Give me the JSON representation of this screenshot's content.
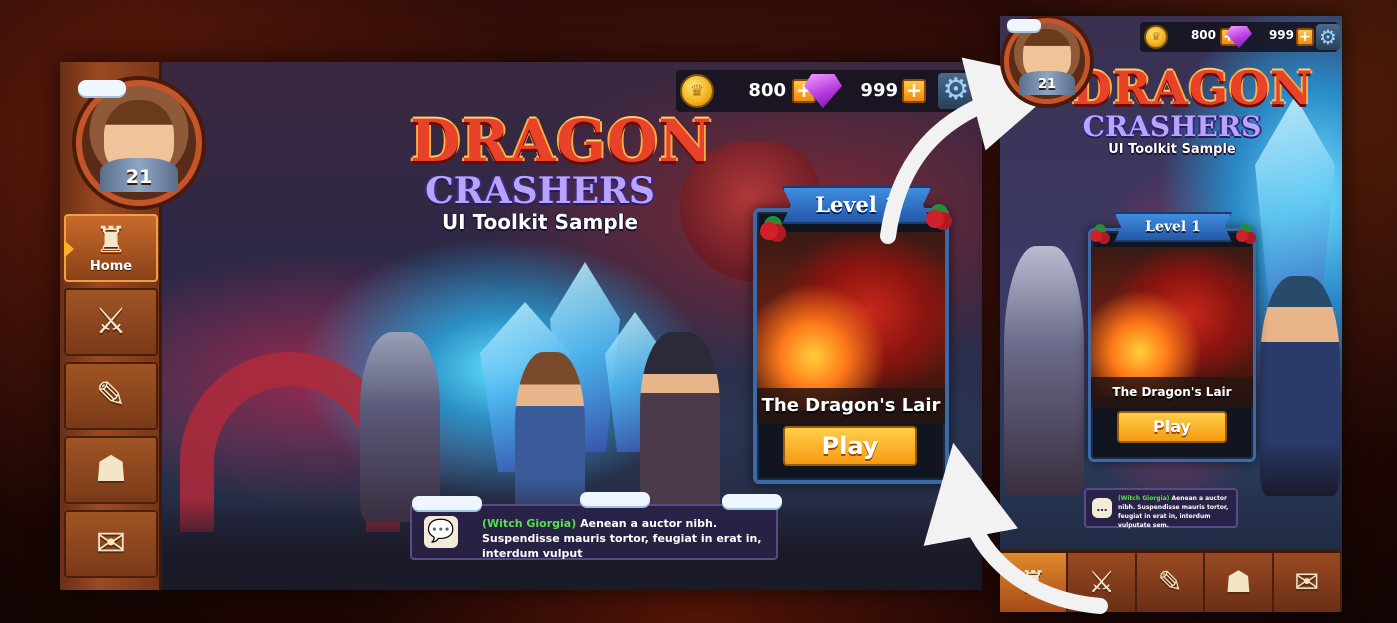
{
  "landscape": {
    "player": {
      "level": "21"
    },
    "nav": [
      {
        "label": "Home",
        "icon": "castle-icon",
        "glyph": "♜",
        "active": true
      },
      {
        "label": "",
        "icon": "shield-sword-icon",
        "glyph": "⚔"
      },
      {
        "label": "",
        "icon": "scroll-quill-icon",
        "glyph": "✎"
      },
      {
        "label": "",
        "icon": "loot-sack-icon",
        "glyph": "☗"
      },
      {
        "label": "",
        "icon": "mail-icon",
        "glyph": "✉"
      }
    ],
    "resources": {
      "gold": "800",
      "gems": "999",
      "plus": "+",
      "gear_glyph": "⚙"
    },
    "logo": {
      "line1": "DRAGON",
      "line2": "CRASHERS",
      "line3": "UI Toolkit Sample"
    },
    "level_card": {
      "title": "Level 1",
      "level_name": "The Dragon's Lair",
      "play_label": "Play"
    },
    "chat": {
      "speaker": "(Witch Giorgia)",
      "message": "Aenean a auctor nibh. Suspendisse mauris tortor, feugiat in erat in, interdum vulput",
      "icon_glyph": "💬"
    }
  },
  "portrait": {
    "player": {
      "level": "21"
    },
    "resources": {
      "gold": "800",
      "gems": "999",
      "plus": "+",
      "gear_glyph": "⚙"
    },
    "logo": {
      "line1": "DRAGON",
      "line2": "CRASHERS",
      "line3": "UI Toolkit Sample"
    },
    "level_card": {
      "title": "Level 1",
      "level_name": "The Dragon's Lair",
      "play_label": "Play"
    },
    "chat": {
      "speaker": "(Witch Giorgia)",
      "message": "Aenean a auctor nibh. Suspendisse mauris tortor, feugiat in erat in, interdum vulputate sem."
    },
    "bottom_nav": [
      {
        "icon": "castle-icon",
        "glyph": "♜",
        "active": true
      },
      {
        "icon": "shield-sword-icon",
        "glyph": "⚔"
      },
      {
        "icon": "scroll-quill-icon",
        "glyph": "✎"
      },
      {
        "icon": "loot-sack-icon",
        "glyph": "☗"
      },
      {
        "icon": "mail-icon",
        "glyph": "✉"
      }
    ]
  },
  "colors": {
    "nav_wood": "#9a4a22",
    "button_orange": "#f59a12",
    "ribbon_blue": "#2458a8",
    "speaker_green": "#58e048",
    "gem_purple": "#b43ae0",
    "coin_gold": "#f2b21a"
  }
}
